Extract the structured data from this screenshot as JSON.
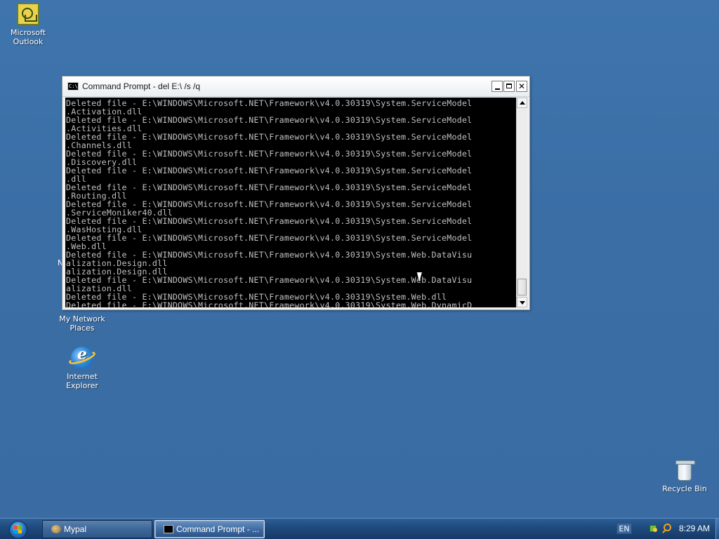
{
  "desktop": {
    "icons": {
      "outlook": "Microsoft Outlook",
      "network": "My Network Places",
      "ie": "Internet Explorer",
      "recycle": "Recycle Bin"
    },
    "ghost_text": "N"
  },
  "cmd": {
    "title": "Command Prompt - del E:\\ /s /q",
    "app_icon_text": "C:\\",
    "lines": [
      "Deleted file - E:\\WINDOWS\\Microsoft.NET\\Framework\\v4.0.30319\\System.ServiceModel",
      ".Activation.dll",
      "Deleted file - E:\\WINDOWS\\Microsoft.NET\\Framework\\v4.0.30319\\System.ServiceModel",
      ".Activities.dll",
      "Deleted file - E:\\WINDOWS\\Microsoft.NET\\Framework\\v4.0.30319\\System.ServiceModel",
      ".Channels.dll",
      "Deleted file - E:\\WINDOWS\\Microsoft.NET\\Framework\\v4.0.30319\\System.ServiceModel",
      ".Discovery.dll",
      "Deleted file - E:\\WINDOWS\\Microsoft.NET\\Framework\\v4.0.30319\\System.ServiceModel",
      ".dll",
      "Deleted file - E:\\WINDOWS\\Microsoft.NET\\Framework\\v4.0.30319\\System.ServiceModel",
      ".Routing.dll",
      "Deleted file - E:\\WINDOWS\\Microsoft.NET\\Framework\\v4.0.30319\\System.ServiceModel",
      ".ServiceMoniker40.dll",
      "Deleted file - E:\\WINDOWS\\Microsoft.NET\\Framework\\v4.0.30319\\System.ServiceModel",
      ".WasHosting.dll",
      "Deleted file - E:\\WINDOWS\\Microsoft.NET\\Framework\\v4.0.30319\\System.ServiceModel",
      ".Web.dll",
      "Deleted file - E:\\WINDOWS\\Microsoft.NET\\Framework\\v4.0.30319\\System.Web.DataVisu",
      "alization.Design.dll",
      "alization.Design.dll",
      "Deleted file - E:\\WINDOWS\\Microsoft.NET\\Framework\\v4.0.30319\\System.Web.DataVisu",
      "alization.dll",
      "Deleted file - E:\\WINDOWS\\Microsoft.NET\\Framework\\v4.0.30319\\System.Web.dll",
      "Deleted file - E:\\WINDOWS\\Microsoft.NET\\Framework\\v4.0.30319\\System.Web.DynamicD"
    ]
  },
  "taskbar": {
    "tasks": [
      "Mypal",
      "Command Prompt - ..."
    ],
    "language": "EN",
    "clock": "8:29 AM"
  }
}
